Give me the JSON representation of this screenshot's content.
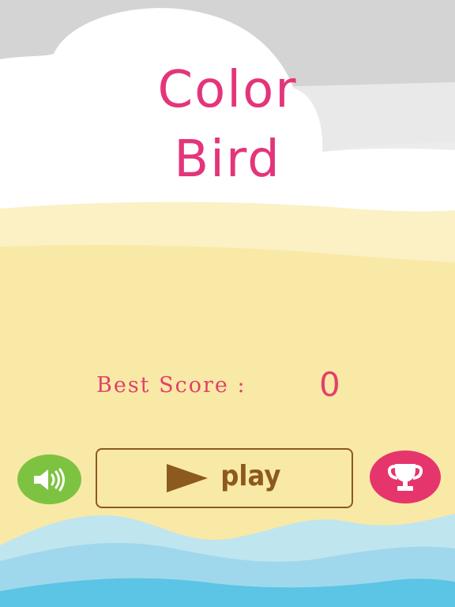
{
  "title": {
    "line1": "Color",
    "line2": "Bird"
  },
  "best_score": {
    "label": "Best Score :",
    "value": "0"
  },
  "controls": {
    "play_label": "play",
    "sound_icon": "speaker-sound-icon",
    "leaderboard_icon": "trophy-icon"
  },
  "colors": {
    "title": "#e4357a",
    "score_text": "#e2406b",
    "play_brown": "#8c5a1e",
    "sound_green": "#7dc341",
    "trophy_pink": "#e6356d",
    "sand": "#f9e9a6",
    "sky_gray": "#d6d6d6",
    "water_light": "#a7dcee",
    "water_deep": "#4dbfe0"
  }
}
